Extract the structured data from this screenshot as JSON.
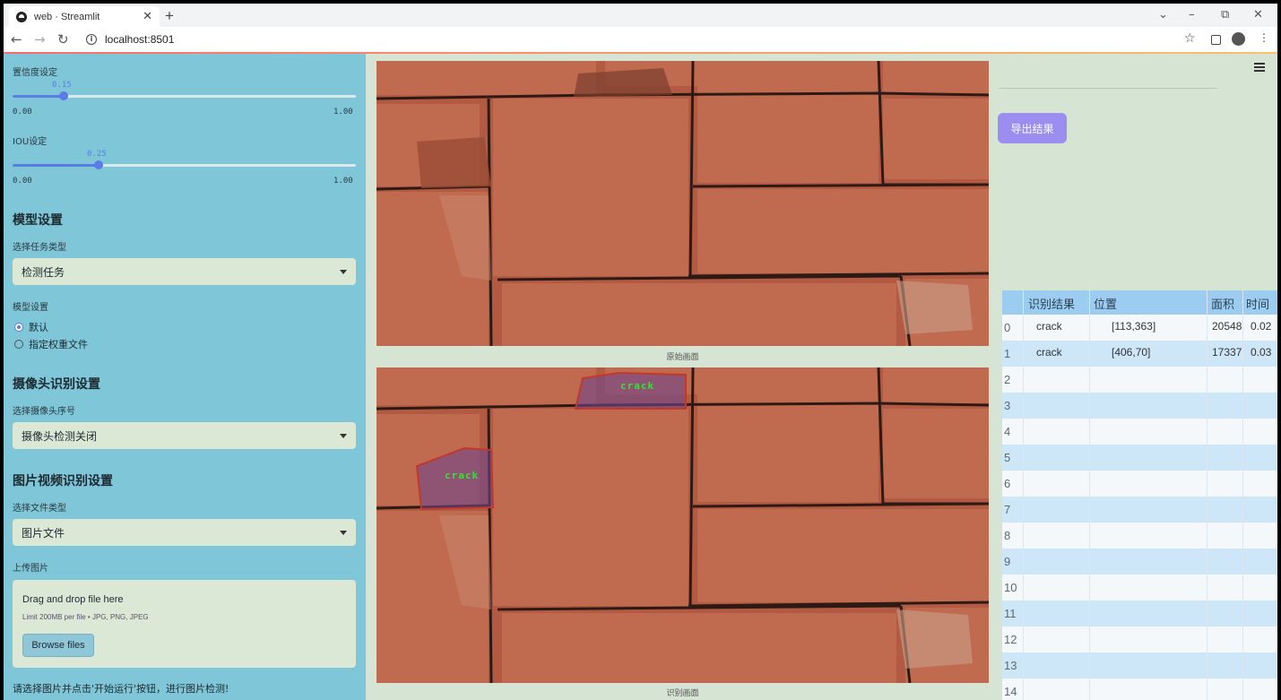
{
  "browser": {
    "tab_title": "web · Streamlit",
    "tab_close": "✕",
    "new_tab": "+",
    "url": "localhost:8501",
    "back": "←",
    "forward": "→",
    "reload": "↻",
    "star": "☆",
    "minimize": "⌄",
    "restore_down": "–",
    "maximize": "⧉",
    "close": "✕"
  },
  "sidebar": {
    "confidence": {
      "label": "置信度设定",
      "value": "0.15",
      "fraction": 0.15,
      "min": "0.00",
      "max": "1.00"
    },
    "iou": {
      "label": "IOU设定",
      "value": "0.25",
      "fraction": 0.25,
      "min": "0.00",
      "max": "1.00"
    },
    "model_section": "模型设置",
    "task_type_label": "选择任务类型",
    "task_type_value": "检测任务",
    "model_label": "模型设置",
    "model_options": [
      "默认",
      "指定权重文件"
    ],
    "model_selected": "默认",
    "camera_section": "摄像头识别设置",
    "camera_label": "选择摄像头序号",
    "camera_value": "摄像头检测关闭",
    "media_section": "图片视频识别设置",
    "file_type_label": "选择文件类型",
    "file_type_value": "图片文件",
    "upload_label": "上传图片",
    "upload_drop": "Drag and drop file here",
    "upload_limit": "Limit 200MB per file • JPG, PNG, JPEG",
    "upload_button": "Browse files",
    "hint": "请选择图片并点击'开始运行'按钮，进行图片检测!"
  },
  "main": {
    "original_caption": "原始画面",
    "result_caption": "识别画面",
    "detection_label": "crack"
  },
  "right": {
    "export_button": "导出结果",
    "table": {
      "columns": [
        "识别结果",
        "位置",
        "面积",
        "时间"
      ],
      "rows": [
        {
          "index": "0",
          "result": "crack",
          "position": "[113,363]",
          "area": "20548",
          "time": "0.02"
        },
        {
          "index": "1",
          "result": "crack",
          "position": "[406,70]",
          "area": "17337",
          "time": "0.03"
        },
        {
          "index": "2"
        },
        {
          "index": "3"
        },
        {
          "index": "4"
        },
        {
          "index": "5"
        },
        {
          "index": "6"
        },
        {
          "index": "7"
        },
        {
          "index": "8"
        },
        {
          "index": "9"
        },
        {
          "index": "10"
        },
        {
          "index": "11"
        },
        {
          "index": "12"
        },
        {
          "index": "13"
        },
        {
          "index": "14"
        }
      ]
    }
  }
}
